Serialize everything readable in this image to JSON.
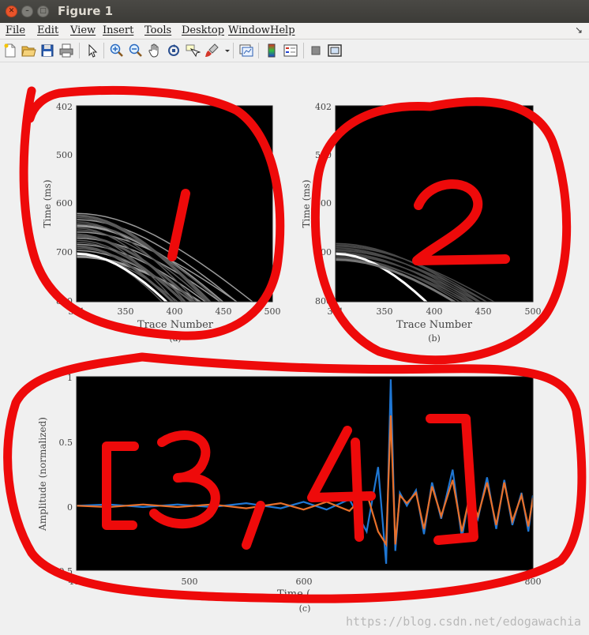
{
  "window": {
    "title": "Figure 1"
  },
  "menu": [
    "File",
    "Edit",
    "View",
    "Insert",
    "Tools",
    "Desktop",
    "Window",
    "Help"
  ],
  "menu_arrow": "↘",
  "toolbar_icons": [
    "new-figure-icon",
    "open-file-icon",
    "save-icon",
    "print-icon",
    "select-arrow-icon",
    "zoom-in-icon",
    "zoom-out-icon",
    "pan-hand-icon",
    "rotate-3d-icon",
    "data-cursor-icon",
    "brush-icon",
    "brush-dropdown-icon",
    "link-plot-icon",
    "insert-colorbar-icon",
    "insert-legend-icon",
    "hide-plot-tools-icon",
    "show-plot-tools-icon"
  ],
  "panels": {
    "a": {
      "y_ticks": [
        "402",
        "500",
        "600",
        "700",
        "800"
      ],
      "x_ticks": [
        "301",
        "350",
        "400",
        "450",
        "500"
      ],
      "xlabel": "Trace Number",
      "ylabel": "Time (ms)",
      "caption": "(a)"
    },
    "b": {
      "y_ticks": [
        "402",
        "500",
        "600",
        "700",
        "800"
      ],
      "x_ticks": [
        "301",
        "350",
        "400",
        "450",
        "500"
      ],
      "xlabel": "Trace Number",
      "ylabel": "Time (ms)",
      "caption": "(b)"
    },
    "c": {
      "y_ticks": [
        "1",
        "0.5",
        "0",
        "-0.5"
      ],
      "x_ticks": [
        "402",
        "500",
        "600",
        "800"
      ],
      "xlabel": "Time (",
      "ylabel": "Amplitude (normalized)",
      "caption": "(c)"
    }
  },
  "annotations": {
    "panel_a": "1",
    "panel_b": "2",
    "panel_c": "[3,4]"
  },
  "chart_data": {
    "type": "line",
    "xlabel": "Time (",
    "ylabel": "Amplitude (normalized)",
    "xlim": [
      402,
      800
    ],
    "ylim": [
      -0.5,
      1
    ],
    "series": [
      {
        "color": "#1f77d4",
        "x": [
          402,
          430,
          460,
          490,
          520,
          550,
          580,
          600,
          620,
          640,
          655,
          665,
          672,
          676,
          680,
          684,
          690,
          698,
          705,
          712,
          720,
          730,
          738,
          745,
          752,
          760,
          768,
          775,
          782,
          790,
          796,
          800
        ],
        "y": [
          0,
          0.01,
          -0.01,
          0.01,
          -0.01,
          0.02,
          -0.02,
          0.03,
          -0.03,
          0.05,
          -0.2,
          0.3,
          -0.45,
          0.98,
          -0.35,
          0.1,
          0,
          0.12,
          -0.22,
          0.18,
          -0.1,
          0.28,
          -0.25,
          0.1,
          -0.1,
          0.22,
          -0.18,
          0.2,
          -0.15,
          0.1,
          -0.2,
          0.08
        ]
      },
      {
        "color": "#e8702a",
        "x": [
          402,
          430,
          460,
          490,
          520,
          550,
          580,
          600,
          620,
          640,
          655,
          665,
          672,
          676,
          680,
          684,
          690,
          698,
          705,
          712,
          720,
          730,
          738,
          745,
          752,
          760,
          768,
          775,
          782,
          790,
          796,
          800
        ],
        "y": [
          0,
          -0.01,
          0.01,
          -0.01,
          0.01,
          -0.02,
          0.02,
          -0.03,
          0.03,
          -0.04,
          0.1,
          -0.2,
          -0.3,
          0.7,
          -0.3,
          0.08,
          0.02,
          0.1,
          -0.18,
          0.15,
          -0.08,
          0.2,
          -0.2,
          0.08,
          -0.08,
          0.18,
          -0.15,
          0.18,
          -0.12,
          0.08,
          -0.16,
          0.06
        ]
      }
    ]
  },
  "watermark": "https://blog.csdn.net/edogawachia"
}
